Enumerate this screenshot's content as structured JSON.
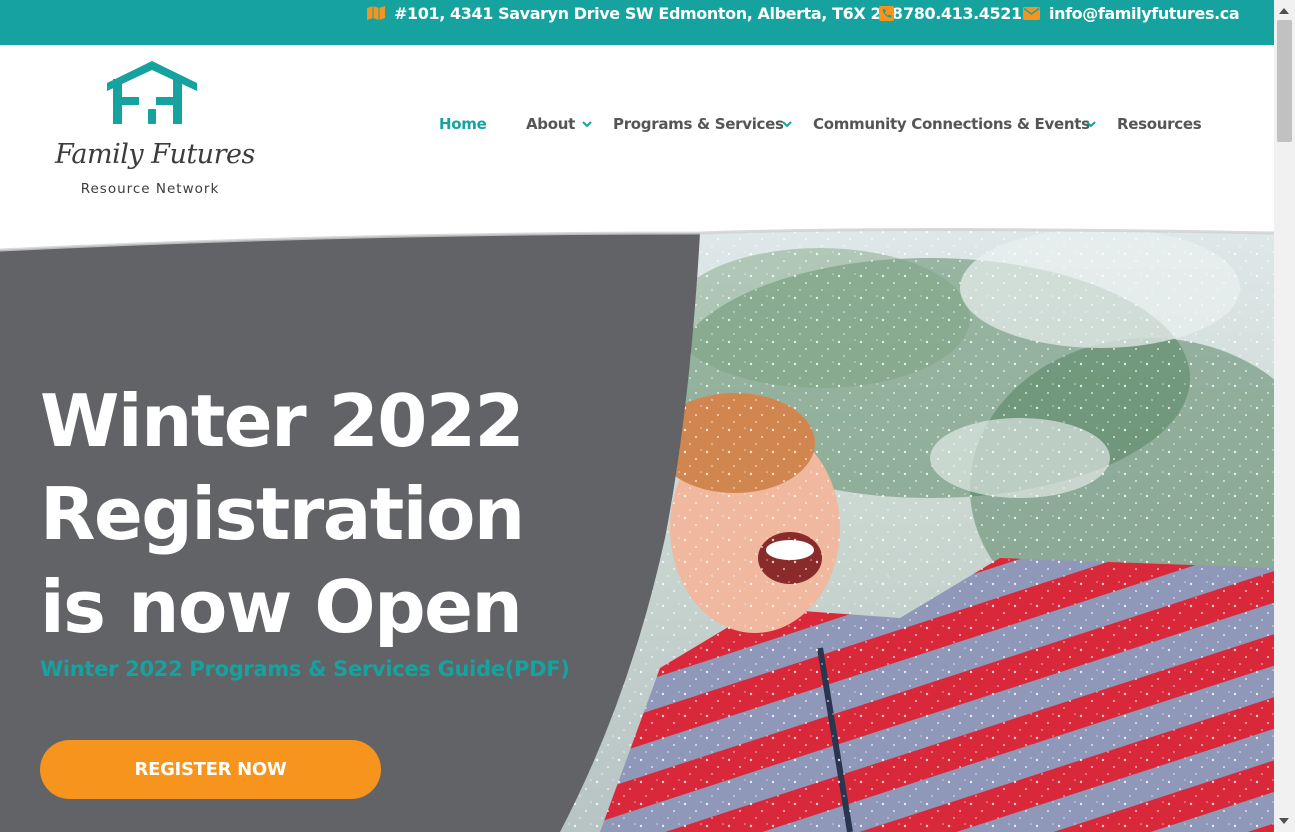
{
  "topbar": {
    "address": "#101, 4341 Savaryn Drive SW Edmonton, Alberta, T6X 2E8",
    "phone": "780.413.4521",
    "email": "info@familyfutures.ca",
    "icon_color": "#f7941d",
    "address_icon": "map-icon",
    "phone_icon": "phone-icon",
    "email_icon": "envelope-icon"
  },
  "logo": {
    "name": "Family Futures",
    "tagline": "Resource Network"
  },
  "nav": {
    "items": [
      {
        "label": "Home",
        "active": true,
        "has_dropdown": false
      },
      {
        "label": "About",
        "active": false,
        "has_dropdown": true
      },
      {
        "label": "Programs & Services",
        "active": false,
        "has_dropdown": true
      },
      {
        "label": "Community Connections & Events",
        "active": false,
        "has_dropdown": true
      },
      {
        "label": "Resources",
        "active": false,
        "has_dropdown": false
      }
    ]
  },
  "hero": {
    "title_lines": [
      "Winter 2022",
      "Registration",
      "is now Open"
    ],
    "guide_link": "Winter 2022 Programs & Services Guide(PDF)",
    "button_label": "REGISTER NOW"
  },
  "colors": {
    "brand_teal": "#16a29e",
    "accent_orange": "#f7941d",
    "hero_panel": "#626366",
    "nav_text": "#555555"
  }
}
